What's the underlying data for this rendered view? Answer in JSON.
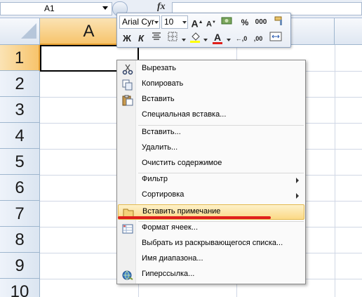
{
  "formula_bar": {
    "name_box": "A1",
    "fx": "fx"
  },
  "columns": {
    "a_label": "A"
  },
  "rows": [
    "1",
    "2",
    "3",
    "4",
    "5",
    "6",
    "7",
    "8",
    "9",
    "10"
  ],
  "mini_toolbar": {
    "font_name": "Arial Cyr",
    "font_size": "10",
    "bold": "Ж",
    "italic": "К",
    "percent": "%",
    "thousands": "000",
    "dec_increase": "←,0",
    "dec_decrease": ",00"
  },
  "context_menu": {
    "items": [
      {
        "label": "Вырезать",
        "icon": "scissors-icon"
      },
      {
        "label": "Копировать",
        "icon": "copy-icon"
      },
      {
        "label": "Вставить",
        "icon": "paste-icon"
      },
      {
        "label": "Специальная вставка..."
      },
      {
        "label": "Вставить..."
      },
      {
        "label": "Удалить..."
      },
      {
        "label": "Очистить содержимое"
      },
      {
        "label": "Фильтр",
        "submenu": true
      },
      {
        "label": "Сортировка",
        "submenu": true
      },
      {
        "label": "Вставить примечание",
        "icon": "comment-icon",
        "highlighted": true
      },
      {
        "label": "Формат ячеек...",
        "icon": "format-cells-icon"
      },
      {
        "label": "Выбрать из раскрывающегося списка..."
      },
      {
        "label": "Имя диапазона..."
      },
      {
        "label": "Гиперссылка...",
        "icon": "hyperlink-icon"
      }
    ]
  },
  "colors": {
    "highlight_bg": "#fbd986",
    "red_underline": "#e0201b",
    "active_header": "#f7c46c"
  }
}
